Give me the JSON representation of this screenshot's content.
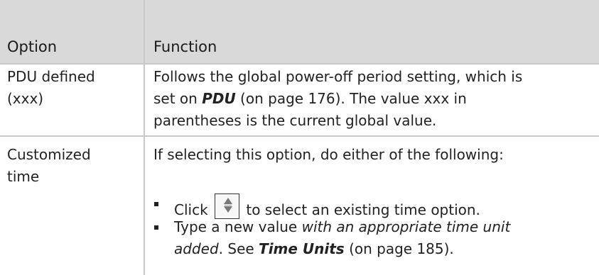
{
  "table": {
    "headers": {
      "option": "Option",
      "function": "Function"
    },
    "row1": {
      "option_line1": "PDU defined",
      "option_line2": "(xxx)",
      "fn_line1": "Follows the global power-off period setting, which is",
      "fn_line2_pre": "set on ",
      "fn_line2_link": "PDU",
      "fn_line2_post": " (on page 176). The value xxx in",
      "fn_line3": "parentheses is the current global value."
    },
    "row2": {
      "option_line1": "Customized",
      "option_line2": "time",
      "fn_intro": "If selecting this option, do either of the following:",
      "bullet1_pre": "Click ",
      "bullet1_post": " to select an existing time option.",
      "bullet2_line1_pre": "Type a new value ",
      "bullet2_line1_em": "with an appropriate time unit",
      "bullet2_line2_em": "added",
      "bullet2_line2_mid": ". See ",
      "bullet2_line2_link": "Time Units",
      "bullet2_line2_post": " (on page 185)."
    }
  }
}
